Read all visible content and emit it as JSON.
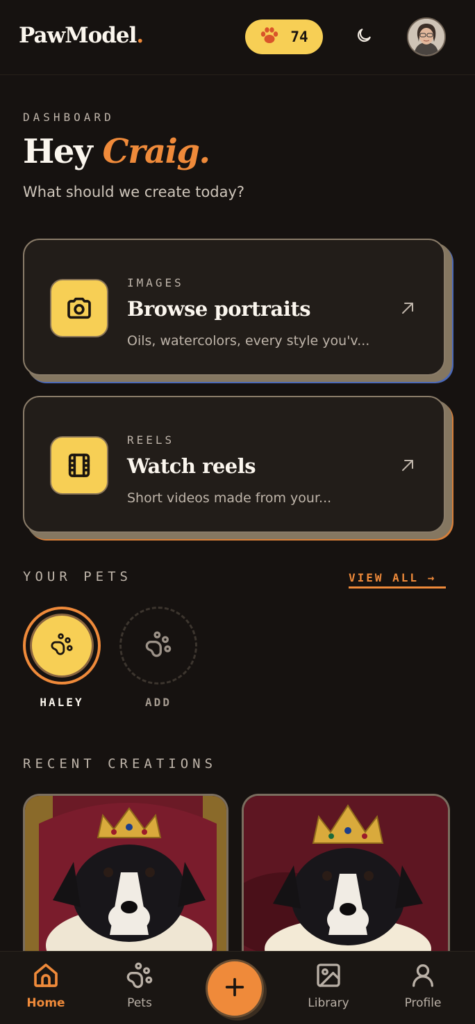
{
  "header": {
    "logo_text": "PawModel",
    "logo_dot": ".",
    "credits": "74"
  },
  "greeting": {
    "eyebrow": "DASHBOARD",
    "hey": "Hey ",
    "name": "Craig.",
    "subtitle": "What should we create today?"
  },
  "cards": [
    {
      "kicker": "IMAGES",
      "title": "Browse portraits",
      "description": "Oils, watercolors, every style you'v...",
      "icon": "camera-icon"
    },
    {
      "kicker": "REELS",
      "title": "Watch reels",
      "description": "Short videos made from your...",
      "icon": "film-icon"
    }
  ],
  "pets": {
    "section_label": "YOUR PETS",
    "view_all": "VIEW ALL →",
    "items": [
      {
        "label": "HALEY",
        "icon": "paw-icon",
        "selected": true
      },
      {
        "label": "ADD",
        "icon": "paw-add-icon",
        "selected": false
      }
    ]
  },
  "creations": {
    "section_label": "RECENT CREATIONS"
  },
  "nav": {
    "items": [
      {
        "label": "Home",
        "icon": "home-icon",
        "active": true
      },
      {
        "label": "Pets",
        "icon": "paw-icon",
        "active": false
      },
      {
        "label": "Library",
        "icon": "image-icon",
        "active": false
      },
      {
        "label": "Profile",
        "icon": "user-icon",
        "active": false
      }
    ],
    "fab_icon": "plus-icon"
  },
  "colors": {
    "accent": "#ef8a3a",
    "yellow": "#f7cf55",
    "background": "#161210",
    "card": "#221d19"
  }
}
